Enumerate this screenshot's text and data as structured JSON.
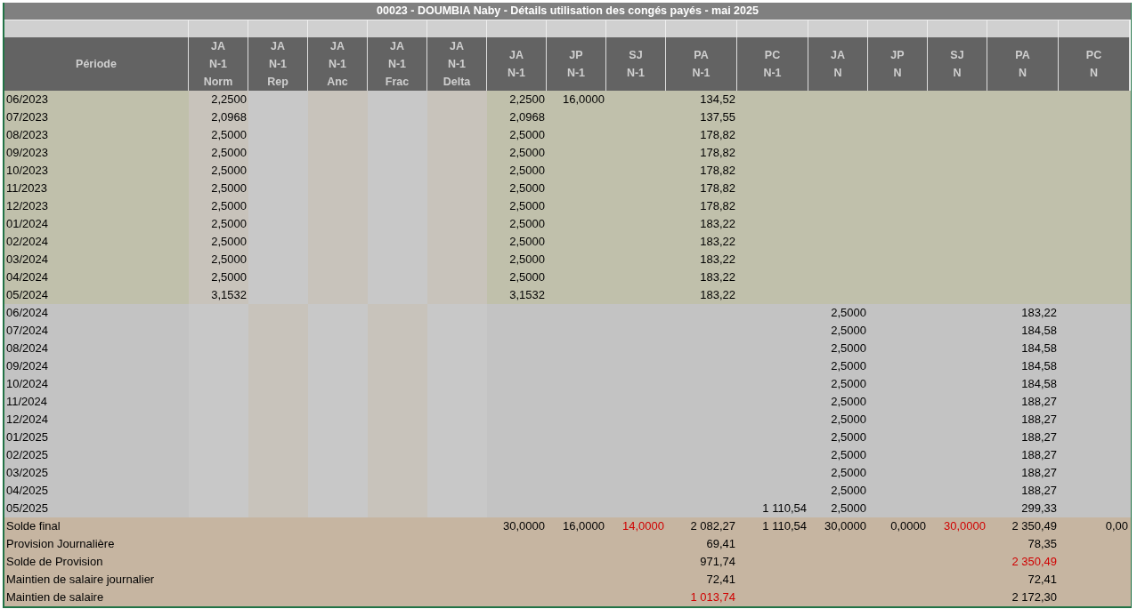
{
  "sheet": {
    "title": "00023 - DOUMBIA Naby - Détails utilisation des congés payés - mai 2025",
    "columns": [
      {
        "lines": [
          "Période"
        ],
        "kind": "label"
      },
      {
        "lines": [
          "JA",
          "N-1",
          "Norm"
        ],
        "kind": "detail"
      },
      {
        "lines": [
          "JA",
          "N-1",
          "Rep"
        ],
        "kind": "detail"
      },
      {
        "lines": [
          "JA",
          "N-1",
          "Anc"
        ],
        "kind": "detail"
      },
      {
        "lines": [
          "JA",
          "N-1",
          "Frac"
        ],
        "kind": "detail"
      },
      {
        "lines": [
          "JA",
          "N-1",
          "Delta"
        ],
        "kind": "detail"
      },
      {
        "lines": [
          "JA",
          "N-1"
        ],
        "kind": "main"
      },
      {
        "lines": [
          "JP",
          "N-1"
        ],
        "kind": "main"
      },
      {
        "lines": [
          "SJ",
          "N-1"
        ],
        "kind": "main"
      },
      {
        "lines": [
          "PA",
          "N-1"
        ],
        "kind": "wide"
      },
      {
        "lines": [
          "PC",
          "N-1"
        ],
        "kind": "wide"
      },
      {
        "lines": [
          "JA",
          "N"
        ],
        "kind": "main"
      },
      {
        "lines": [
          "JP",
          "N"
        ],
        "kind": "main"
      },
      {
        "lines": [
          "SJ",
          "N"
        ],
        "kind": "main"
      },
      {
        "lines": [
          "PA",
          "N"
        ],
        "kind": "wide"
      },
      {
        "lines": [
          "PC",
          "N"
        ],
        "kind": "wide"
      }
    ],
    "rows": [
      {
        "kind": "previous",
        "cells": [
          {
            "text": "06/2023",
            "highlighted": false
          },
          {
            "text": "2,2500",
            "highlighted": false
          },
          "",
          "",
          "",
          "",
          {
            "text": "2,2500",
            "highlighted": false
          },
          {
            "text": "16,0000",
            "highlighted": false
          },
          "",
          {
            "text": "134,52",
            "highlighted": false
          },
          "",
          "",
          "",
          "",
          "",
          ""
        ]
      },
      {
        "kind": "previous",
        "cells": [
          {
            "text": "07/2023",
            "highlighted": false
          },
          {
            "text": "2,0968",
            "highlighted": false
          },
          "",
          "",
          "",
          "",
          {
            "text": "2,0968",
            "highlighted": false
          },
          "",
          "",
          {
            "text": "137,55",
            "highlighted": false
          },
          "",
          "",
          "",
          "",
          "",
          ""
        ]
      },
      {
        "kind": "previous",
        "cells": [
          {
            "text": "08/2023",
            "highlighted": false
          },
          {
            "text": "2,5000",
            "highlighted": false
          },
          "",
          "",
          "",
          "",
          {
            "text": "2,5000",
            "highlighted": false
          },
          "",
          "",
          {
            "text": "178,82",
            "highlighted": false
          },
          "",
          "",
          "",
          "",
          "",
          ""
        ]
      },
      {
        "kind": "previous",
        "cells": [
          {
            "text": "09/2023",
            "highlighted": false
          },
          {
            "text": "2,5000",
            "highlighted": false
          },
          "",
          "",
          "",
          "",
          {
            "text": "2,5000",
            "highlighted": false
          },
          "",
          "",
          {
            "text": "178,82",
            "highlighted": false
          },
          "",
          "",
          "",
          "",
          "",
          ""
        ]
      },
      {
        "kind": "previous",
        "cells": [
          {
            "text": "10/2023",
            "highlighted": false
          },
          {
            "text": "2,5000",
            "highlighted": false
          },
          "",
          "",
          "",
          "",
          {
            "text": "2,5000",
            "highlighted": false
          },
          "",
          "",
          {
            "text": "178,82",
            "highlighted": false
          },
          "",
          "",
          "",
          "",
          "",
          ""
        ]
      },
      {
        "kind": "previous",
        "cells": [
          {
            "text": "11/2023",
            "highlighted": false
          },
          {
            "text": "2,5000",
            "highlighted": false
          },
          "",
          "",
          "",
          "",
          {
            "text": "2,5000",
            "highlighted": false
          },
          "",
          "",
          {
            "text": "178,82",
            "highlighted": false
          },
          "",
          "",
          "",
          "",
          "",
          ""
        ]
      },
      {
        "kind": "previous",
        "cells": [
          {
            "text": "12/2023",
            "highlighted": false
          },
          {
            "text": "2,5000",
            "highlighted": false
          },
          "",
          "",
          "",
          "",
          {
            "text": "2,5000",
            "highlighted": false
          },
          "",
          "",
          {
            "text": "178,82",
            "highlighted": false
          },
          "",
          "",
          "",
          "",
          "",
          ""
        ]
      },
      {
        "kind": "previous",
        "cells": [
          {
            "text": "01/2024",
            "highlighted": false
          },
          {
            "text": "2,5000",
            "highlighted": false
          },
          "",
          "",
          "",
          "",
          {
            "text": "2,5000",
            "highlighted": false
          },
          "",
          "",
          {
            "text": "183,22",
            "highlighted": false
          },
          "",
          "",
          "",
          "",
          "",
          ""
        ]
      },
      {
        "kind": "previous",
        "cells": [
          {
            "text": "02/2024",
            "highlighted": false
          },
          {
            "text": "2,5000",
            "highlighted": false
          },
          "",
          "",
          "",
          "",
          {
            "text": "2,5000",
            "highlighted": false
          },
          "",
          "",
          {
            "text": "183,22",
            "highlighted": false
          },
          "",
          "",
          "",
          "",
          "",
          ""
        ]
      },
      {
        "kind": "previous",
        "cells": [
          {
            "text": "03/2024",
            "highlighted": false
          },
          {
            "text": "2,5000",
            "highlighted": false
          },
          "",
          "",
          "",
          "",
          {
            "text": "2,5000",
            "highlighted": false
          },
          "",
          "",
          {
            "text": "183,22",
            "highlighted": false
          },
          "",
          "",
          "",
          "",
          "",
          ""
        ]
      },
      {
        "kind": "previous",
        "cells": [
          {
            "text": "04/2024",
            "highlighted": false
          },
          {
            "text": "2,5000",
            "highlighted": false
          },
          "",
          "",
          "",
          "",
          {
            "text": "2,5000",
            "highlighted": false
          },
          "",
          "",
          {
            "text": "183,22",
            "highlighted": false
          },
          "",
          "",
          "",
          "",
          "",
          ""
        ]
      },
      {
        "kind": "previous",
        "cells": [
          {
            "text": "05/2024",
            "highlighted": false
          },
          {
            "text": "3,1532",
            "highlighted": false
          },
          "",
          "",
          "",
          "",
          {
            "text": "3,1532",
            "highlighted": false
          },
          "",
          "",
          {
            "text": "183,22",
            "highlighted": false
          },
          "",
          "",
          "",
          "",
          "",
          ""
        ]
      },
      {
        "kind": "current",
        "cells": [
          {
            "text": "06/2024",
            "highlighted": false
          },
          "",
          "",
          "",
          "",
          "",
          "",
          "",
          "",
          "",
          "",
          {
            "text": "2,5000",
            "highlighted": false
          },
          "",
          "",
          {
            "text": "183,22",
            "highlighted": false
          },
          ""
        ]
      },
      {
        "kind": "current",
        "cells": [
          {
            "text": "07/2024",
            "highlighted": false
          },
          "",
          "",
          "",
          "",
          "",
          "",
          "",
          "",
          "",
          "",
          {
            "text": "2,5000",
            "highlighted": false
          },
          "",
          "",
          {
            "text": "184,58",
            "highlighted": false
          },
          ""
        ]
      },
      {
        "kind": "current",
        "cells": [
          {
            "text": "08/2024",
            "highlighted": false
          },
          "",
          "",
          "",
          "",
          "",
          "",
          "",
          "",
          "",
          "",
          {
            "text": "2,5000",
            "highlighted": false
          },
          "",
          "",
          {
            "text": "184,58",
            "highlighted": false
          },
          ""
        ]
      },
      {
        "kind": "current",
        "cells": [
          {
            "text": "09/2024",
            "highlighted": false
          },
          "",
          "",
          "",
          "",
          "",
          "",
          "",
          "",
          "",
          "",
          {
            "text": "2,5000",
            "highlighted": false
          },
          "",
          "",
          {
            "text": "184,58",
            "highlighted": false
          },
          ""
        ]
      },
      {
        "kind": "current",
        "cells": [
          {
            "text": "10/2024",
            "highlighted": false
          },
          "",
          "",
          "",
          "",
          "",
          "",
          "",
          "",
          "",
          "",
          {
            "text": "2,5000",
            "highlighted": false
          },
          "",
          "",
          {
            "text": "184,58",
            "highlighted": false
          },
          ""
        ]
      },
      {
        "kind": "current",
        "cells": [
          {
            "text": "11/2024",
            "highlighted": false
          },
          "",
          "",
          "",
          "",
          "",
          "",
          "",
          "",
          "",
          "",
          {
            "text": "2,5000",
            "highlighted": false
          },
          "",
          "",
          {
            "text": "188,27",
            "highlighted": false
          },
          ""
        ]
      },
      {
        "kind": "current",
        "cells": [
          {
            "text": "12/2024",
            "highlighted": false
          },
          "",
          "",
          "",
          "",
          "",
          "",
          "",
          "",
          "",
          "",
          {
            "text": "2,5000",
            "highlighted": false
          },
          "",
          "",
          {
            "text": "188,27",
            "highlighted": false
          },
          ""
        ]
      },
      {
        "kind": "current",
        "cells": [
          {
            "text": "01/2025",
            "highlighted": false
          },
          "",
          "",
          "",
          "",
          "",
          "",
          "",
          "",
          "",
          "",
          {
            "text": "2,5000",
            "highlighted": false
          },
          "",
          "",
          {
            "text": "188,27",
            "highlighted": false
          },
          ""
        ]
      },
      {
        "kind": "current",
        "cells": [
          {
            "text": "02/2025",
            "highlighted": false
          },
          "",
          "",
          "",
          "",
          "",
          "",
          "",
          "",
          "",
          "",
          {
            "text": "2,5000",
            "highlighted": false
          },
          "",
          "",
          {
            "text": "188,27",
            "highlighted": false
          },
          ""
        ]
      },
      {
        "kind": "current",
        "cells": [
          {
            "text": "03/2025",
            "highlighted": false
          },
          "",
          "",
          "",
          "",
          "",
          "",
          "",
          "",
          "",
          "",
          {
            "text": "2,5000",
            "highlighted": false
          },
          "",
          "",
          {
            "text": "188,27",
            "highlighted": false
          },
          ""
        ]
      },
      {
        "kind": "current",
        "cells": [
          {
            "text": "04/2025",
            "highlighted": false
          },
          "",
          "",
          "",
          "",
          "",
          "",
          "",
          "",
          "",
          "",
          {
            "text": "2,5000",
            "highlighted": false
          },
          "",
          "",
          {
            "text": "188,27",
            "highlighted": false
          },
          ""
        ]
      },
      {
        "kind": "current",
        "cells": [
          {
            "text": "05/2025",
            "highlighted": false
          },
          "",
          "",
          "",
          "",
          "",
          "",
          "",
          "",
          "",
          {
            "text": "1 110,54",
            "highlighted": false
          },
          {
            "text": "2,5000",
            "highlighted": false
          },
          "",
          "",
          {
            "text": "299,33",
            "highlighted": false
          },
          ""
        ]
      },
      {
        "kind": "total",
        "cells": [
          {
            "text": "Solde final",
            "highlighted": false
          },
          "",
          "",
          "",
          "",
          "",
          {
            "text": "30,0000",
            "highlighted": false
          },
          {
            "text": "16,0000",
            "highlighted": false
          },
          {
            "text": "14,0000",
            "highlighted": true
          },
          {
            "text": "2 082,27",
            "highlighted": false
          },
          {
            "text": "1 110,54",
            "highlighted": false
          },
          {
            "text": "30,0000",
            "highlighted": false
          },
          {
            "text": "0,0000",
            "highlighted": false
          },
          {
            "text": "30,0000",
            "highlighted": true
          },
          {
            "text": "2 350,49",
            "highlighted": false
          },
          {
            "text": "0,00",
            "highlighted": false
          }
        ]
      },
      {
        "kind": "total",
        "cells": [
          {
            "text": "Provision Journalière",
            "highlighted": false
          },
          "",
          "",
          "",
          "",
          "",
          "",
          "",
          "",
          {
            "text": "69,41",
            "highlighted": false
          },
          "",
          "",
          "",
          "",
          {
            "text": "78,35",
            "highlighted": false
          },
          ""
        ]
      },
      {
        "kind": "total",
        "cells": [
          {
            "text": "Solde de Provision",
            "highlighted": false
          },
          "",
          "",
          "",
          "",
          "",
          "",
          "",
          "",
          {
            "text": "971,74",
            "highlighted": false
          },
          "",
          "",
          "",
          "",
          {
            "text": "2 350,49",
            "highlighted": true
          },
          ""
        ]
      },
      {
        "kind": "total",
        "cells": [
          {
            "text": "Maintien de salaire journalier",
            "highlighted": false
          },
          "",
          "",
          "",
          "",
          "",
          "",
          "",
          "",
          {
            "text": "72,41",
            "highlighted": false
          },
          "",
          "",
          "",
          "",
          {
            "text": "72,41",
            "highlighted": false
          },
          ""
        ]
      },
      {
        "kind": "total",
        "cells": [
          {
            "text": "Maintien de salaire",
            "highlighted": false
          },
          "",
          "",
          "",
          "",
          "",
          "",
          "",
          "",
          {
            "text": "1 013,74",
            "highlighted": true
          },
          "",
          "",
          "",
          "",
          {
            "text": "2 172,30",
            "highlighted": false
          },
          ""
        ]
      }
    ]
  }
}
